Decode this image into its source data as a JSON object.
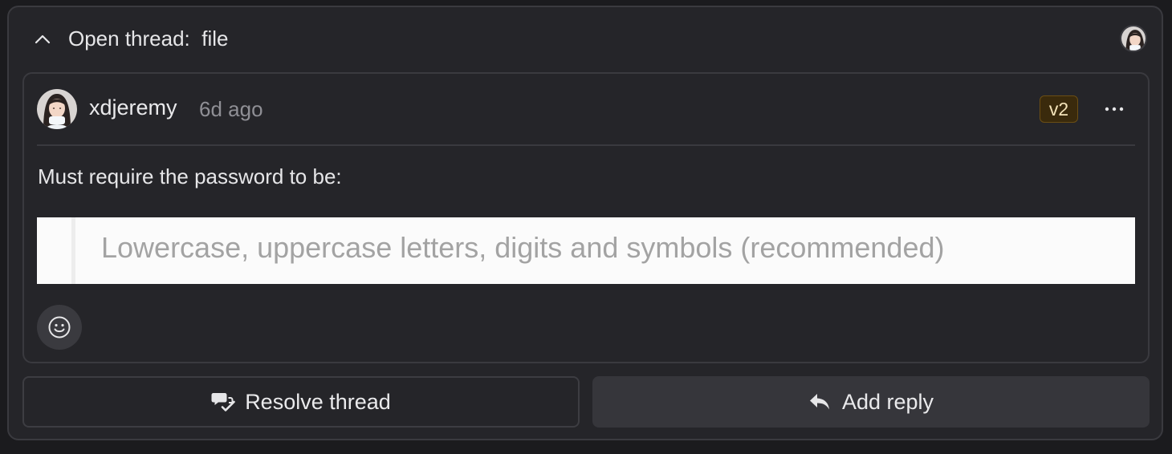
{
  "thread": {
    "label": "Open thread:",
    "target": "file",
    "title_separator": "  "
  },
  "comment": {
    "author": "xdjeremy",
    "time": "6d ago",
    "version_badge": "v2",
    "body": "Must require the password to be:",
    "quoted_image_text": "Lowercase, uppercase letters, digits and symbols (recommended)"
  },
  "actions": {
    "resolve_label": "Resolve thread",
    "reply_label": "Add reply"
  },
  "icons": {
    "collapse": "chevron-up-icon",
    "more": "more-horizontal-icon",
    "emoji": "smiley-icon",
    "resolve": "chat-check-icon",
    "reply": "reply-arrow-icon"
  },
  "colors": {
    "panel_bg": "#252529",
    "badge_bg": "#3a2a0c",
    "badge_text": "#f3e2b8",
    "reply_button_bg": "#36363b"
  }
}
